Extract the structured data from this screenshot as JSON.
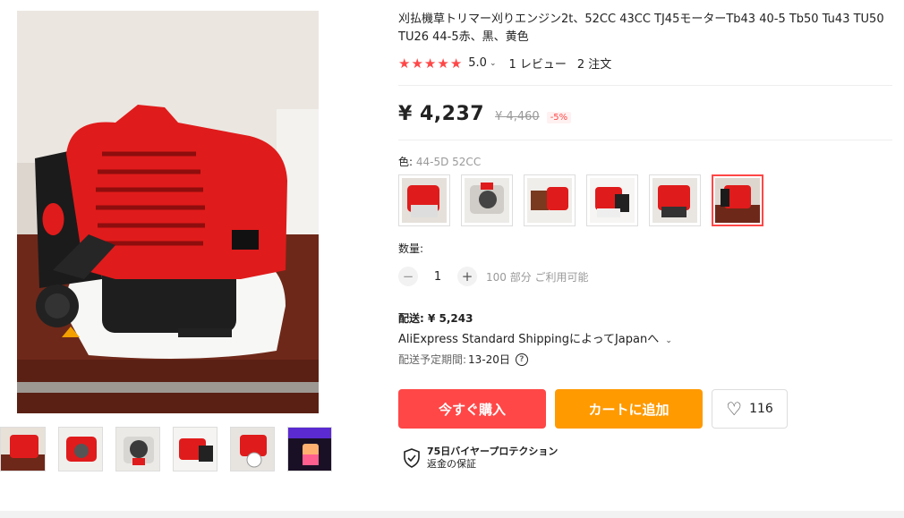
{
  "product": {
    "title": "刈払機草トリマー刈りエンジン2t、52CC 43CC TJ45モーターTb43 40-5 Tb50 Tu43 TU50 TU26 44-5赤、黒、黄色",
    "rating": "5.0",
    "reviews": "1 レビュー",
    "orders": "2 注文",
    "price": "¥ 4,237",
    "original_price": "¥ 4,460",
    "discount": "-5%"
  },
  "color": {
    "label": "色:",
    "selected_value": "44-5D 52CC",
    "variant_count": 6,
    "selected_index": 5
  },
  "quantity": {
    "label": "数量:",
    "value": "1",
    "minus": "−",
    "plus": "+",
    "available": "100 部分 ご利用可能"
  },
  "shipping": {
    "label": "配送:",
    "cost": "¥ 5,243",
    "method": "AliExpress Standard ShippingによってJapanへ",
    "delivery_label": "配送予定期間:",
    "delivery_days": "13-20日"
  },
  "actions": {
    "buy_now": "今すぐ購入",
    "add_to_cart": "カートに追加",
    "wishlist_count": "116"
  },
  "protection": {
    "line1": "75日バイヤープロテクション",
    "line2": "返金の保証"
  },
  "colors": {
    "accent_red": "#ff4747",
    "accent_orange": "#ff9a00",
    "engine_red": "#e01b1b"
  }
}
